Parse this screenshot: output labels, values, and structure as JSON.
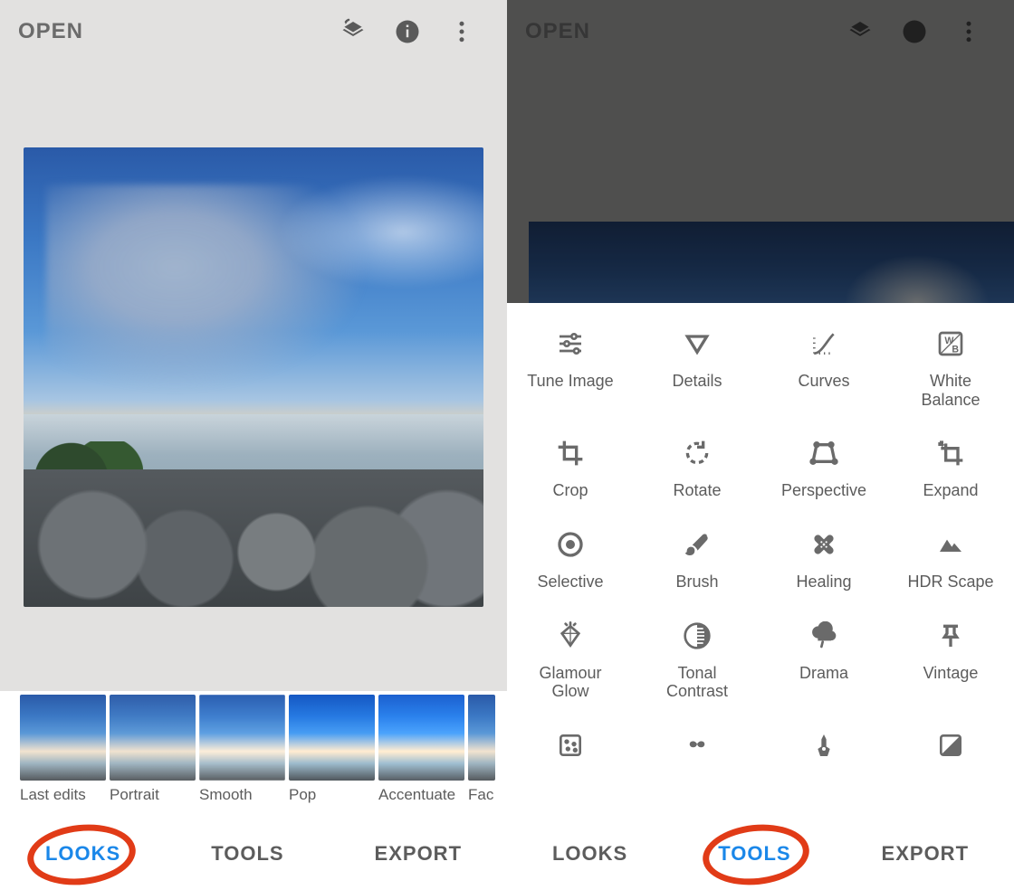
{
  "left": {
    "topbar": {
      "open": "OPEN"
    },
    "thumbs": [
      {
        "label": "Last edits"
      },
      {
        "label": "Portrait"
      },
      {
        "label": "Smooth"
      },
      {
        "label": "Pop"
      },
      {
        "label": "Accentuate"
      },
      {
        "label": "Fac"
      }
    ],
    "tabs": {
      "looks": "LOOKS",
      "tools": "TOOLS",
      "export": "EXPORT"
    }
  },
  "right": {
    "topbar": {
      "open": "OPEN"
    },
    "tools": [
      {
        "id": "tune-image",
        "label": "Tune Image"
      },
      {
        "id": "details",
        "label": "Details"
      },
      {
        "id": "curves",
        "label": "Curves"
      },
      {
        "id": "white-balance",
        "label": "White\nBalance"
      },
      {
        "id": "crop",
        "label": "Crop"
      },
      {
        "id": "rotate",
        "label": "Rotate"
      },
      {
        "id": "perspective",
        "label": "Perspective"
      },
      {
        "id": "expand",
        "label": "Expand"
      },
      {
        "id": "selective",
        "label": "Selective"
      },
      {
        "id": "brush",
        "label": "Brush"
      },
      {
        "id": "healing",
        "label": "Healing"
      },
      {
        "id": "hdr-scape",
        "label": "HDR Scape"
      },
      {
        "id": "glamour-glow",
        "label": "Glamour\nGlow"
      },
      {
        "id": "tonal-contrast",
        "label": "Tonal\nContrast"
      },
      {
        "id": "drama",
        "label": "Drama"
      },
      {
        "id": "vintage",
        "label": "Vintage"
      },
      {
        "id": "grainy-film",
        "label": ""
      },
      {
        "id": "retrolux",
        "label": ""
      },
      {
        "id": "grunge",
        "label": ""
      },
      {
        "id": "bw",
        "label": ""
      }
    ],
    "tabs": {
      "looks": "LOOKS",
      "tools": "TOOLS",
      "export": "EXPORT"
    }
  },
  "colors": {
    "accent": "#1a87e9",
    "annot": "#e13b17"
  }
}
